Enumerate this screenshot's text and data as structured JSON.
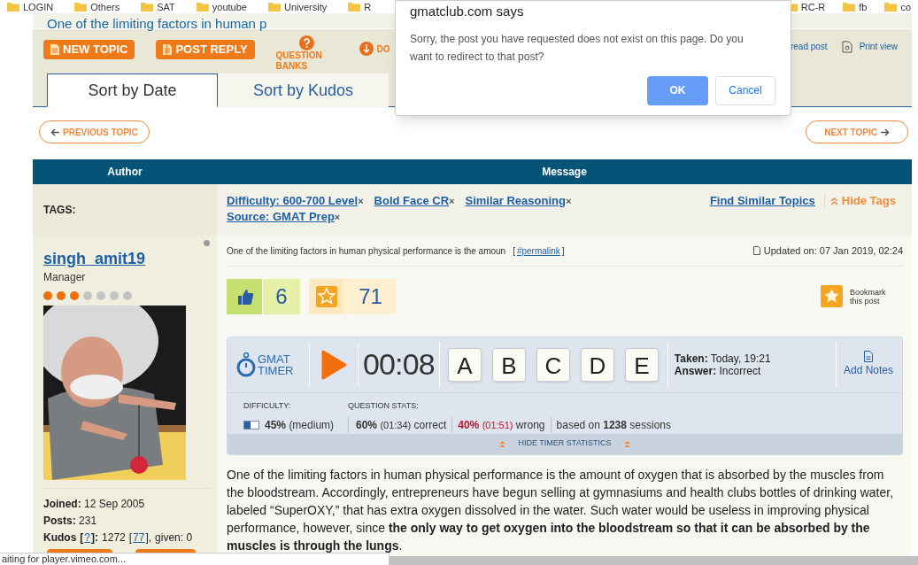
{
  "bookmarks": [
    "LOGIN",
    "Others",
    "SAT",
    "youtube",
    "University",
    "R"
  ],
  "bookmarks_right": [
    "RC-R",
    "fb",
    "co"
  ],
  "topic_title": "One of the limiting factors in human p",
  "toolbar": {
    "buttons": [
      {
        "label": "NEW TOPIC",
        "kind": "new"
      },
      {
        "label": "POST REPLY",
        "kind": "reply"
      }
    ],
    "question_banks": "QUESTION BANKS",
    "download": "DO",
    "read_post": "read post",
    "print_view": "Print view"
  },
  "tabs": [
    {
      "label": "Sort by Date",
      "selected": true
    },
    {
      "label": "Sort by Kudos",
      "selected": false
    }
  ],
  "nav": {
    "previous": "PREVIOUS TOPIC",
    "next": "NEXT TOPIC"
  },
  "table": {
    "columns": [
      "Author",
      "Message"
    ]
  },
  "tags": {
    "label": "TAGS:",
    "items": [
      "Difficulty: 600-700 Level",
      "Bold Face CR",
      "Similar Reasoning",
      "Source: GMAT Prep"
    ],
    "remove_mark": "×",
    "find_similar": "Find Similar Topics",
    "hide_tags": "Hide Tags"
  },
  "author": {
    "name": "singh_amit19",
    "rank": "Manager",
    "online": false,
    "rank_dots": [
      {
        "filled": true
      },
      {
        "filled": true
      },
      {
        "filled": true
      },
      {
        "filled": false
      },
      {
        "filled": false
      },
      {
        "filled": false
      },
      {
        "filled": false
      }
    ],
    "stats": [
      {
        "label": "Joined:",
        "value": "12 Sep 2005"
      },
      {
        "label": "Posts:",
        "value": "231"
      }
    ],
    "kudos": {
      "label": "Kudos",
      "help_open": "[",
      "help": "?",
      "help_close": "]:",
      "received": "1272",
      "link_open": "[",
      "link": "77",
      "link_close": "],",
      "given": "given: 0"
    }
  },
  "post": {
    "subject": "One of the limiting factors in human physical performance is the amoun",
    "permalink_open": "[",
    "permalink": "#permalink",
    "permalink_close": "]",
    "updated": "Updated on: 07 Jan 2019, 02:24",
    "kudos_count": "6",
    "bookmark_count": "71",
    "bookmark_label": "Bookmark this post"
  },
  "timer": {
    "logo_top": "GMAT",
    "logo_bottom": "TIMER",
    "time": "00:08",
    "choices": [
      "A",
      "B",
      "C",
      "D",
      "E"
    ],
    "taken_label": "Taken:",
    "taken": "Today, 19:21",
    "answer_label": "Answer:",
    "answer": "Incorrect",
    "add_notes": "Add Notes",
    "difficulty_label": "DIFFICULTY:",
    "difficulty_meter": {
      "level": 0.45
    },
    "difficulty_pct": "45%",
    "difficulty_text": "(medium)",
    "stats_label": "QUESTION STATS:",
    "correct_pct": "60%",
    "correct_time": "(01:34)",
    "correct_text": "correct",
    "wrong_pct": "40%",
    "wrong_time": "(01:51)",
    "wrong_text": "wrong",
    "sessions": "based on **1238** sessions",
    "hide_stats": "HIDE TIMER STATISTICS"
  },
  "body": "One of the limiting factors in human physical performance is the amount of oxygen that is absorbed by the muscles from the bloodstream. Accordingly, entrepreneurs have begun selling at gymnasiums and health clubs bottles of drinking water, labeled “SuperOXY,” that has extra oxygen dissolved in the water. Such water would be useless in improving physical performance, however, since **the only way to get oxygen into the bloodstream so that it can be absorbed by the muscles is through the lungs**.",
  "dialog": {
    "title": "gmatclub.com says",
    "message": "Sorry, the post you have requested does not exist on this page. Do you want to redirect to that post?",
    "ok": "OK",
    "cancel": "Cancel"
  },
  "status_bar": "aiting for player.vimeo.com..."
}
